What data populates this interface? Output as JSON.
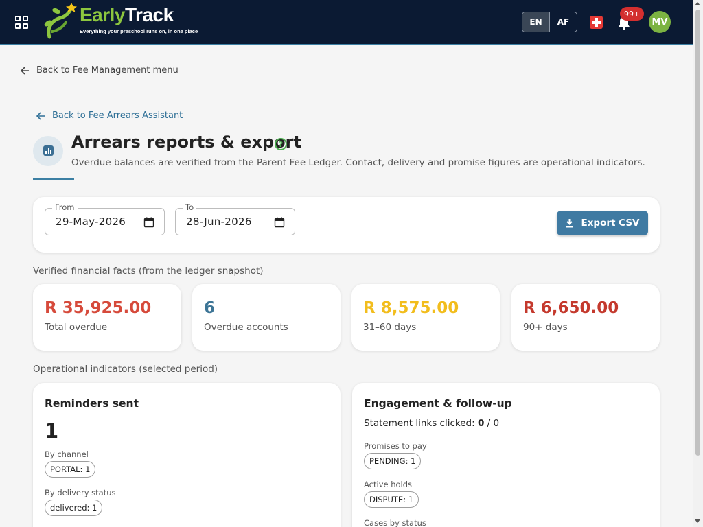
{
  "header": {
    "logo": {
      "word_early": "Early",
      "word_track": "Track",
      "tagline": "Everything your preschool runs on, in one place"
    },
    "languages": [
      {
        "label": "EN",
        "active": true
      },
      {
        "label": "AF",
        "active": false
      }
    ],
    "notification_badge": "99+",
    "avatar_initials": "MV",
    "icons": {
      "apps": "apps-grid-icon",
      "medical": "first-aid-icon",
      "bell": "bell-icon"
    }
  },
  "nav": {
    "back_fee_management": "Back to Fee Management menu",
    "back_arrears_assistant": "Back to Fee Arrears Assistant"
  },
  "page": {
    "title": "Arrears reports & export",
    "help": "?",
    "subtitle": "Overdue balances are verified from the Parent Fee Ledger. Contact, delivery and promise figures are operational indicators."
  },
  "filters": {
    "from_label": "From",
    "from_value": "29-May-2026",
    "to_label": "To",
    "to_value": "28-Jun-2026",
    "export_label": "Export CSV"
  },
  "financial": {
    "section_label": "Verified financial facts (from the ledger snapshot)",
    "cards": [
      {
        "value": "R 35,925.00",
        "label": "Total overdue",
        "color": "#d64a3b"
      },
      {
        "value": "6",
        "label": "Overdue accounts",
        "color": "#3d7596"
      },
      {
        "value": "R 8,575.00",
        "label": "31–60 days",
        "color": "#f2bd1d"
      },
      {
        "value": "R 6,650.00",
        "label": "90+ days",
        "color": "#c4392d"
      }
    ]
  },
  "operational": {
    "section_label": "Operational indicators (selected period)",
    "reminders": {
      "title": "Reminders sent",
      "count": "1",
      "by_channel_label": "By channel",
      "by_channel_chip": "PORTAL: 1",
      "by_delivery_label": "By delivery status",
      "by_delivery_chip": "delivered: 1"
    },
    "engagement": {
      "title": "Engagement & follow-up",
      "links_label": "Statement links clicked:",
      "links_clicked": "0",
      "links_sep": " / ",
      "links_total": "0",
      "promises_label": "Promises to pay",
      "promises_chip": "PENDING: 1",
      "holds_label": "Active holds",
      "holds_chip": "DISPUTE: 1",
      "cases_label": "Cases by status"
    }
  },
  "colors": {
    "topbar": "#0b1a33",
    "accent": "#3f7aa2",
    "logo_green": "#8dc63f"
  }
}
